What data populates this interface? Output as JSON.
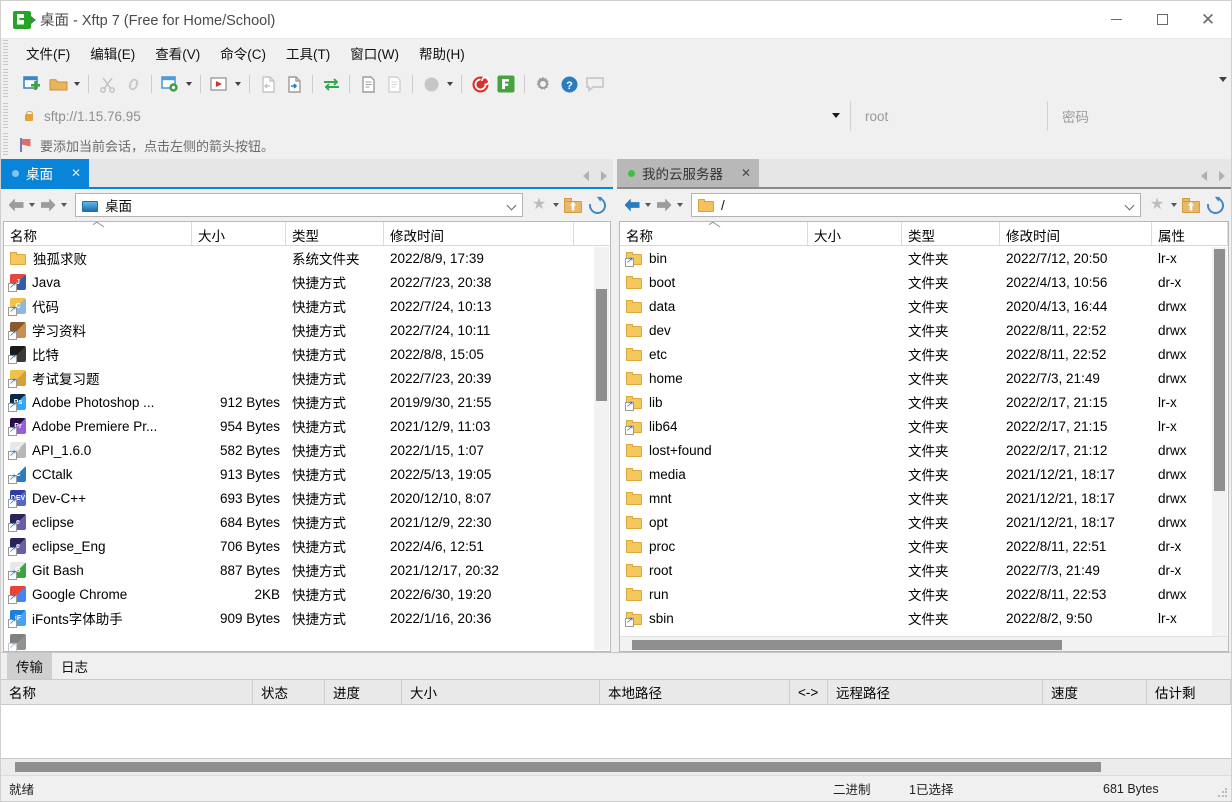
{
  "window": {
    "title": "桌面 - Xftp 7 (Free for Home/School)",
    "app_icon": "xftp-icon",
    "minimize_label": "",
    "maximize_label": "",
    "close_label": "✕"
  },
  "menubar": {
    "items": [
      {
        "label": "文件(F)"
      },
      {
        "label": "编辑(E)"
      },
      {
        "label": "查看(V)"
      },
      {
        "label": "命令(C)"
      },
      {
        "label": "工具(T)"
      },
      {
        "label": "窗口(W)"
      },
      {
        "label": "帮助(H)"
      }
    ]
  },
  "toolbar": {
    "buttons": [
      {
        "name": "new-session-icon",
        "color": "#3f87c8"
      },
      {
        "name": "open-folder-icon",
        "color": "#e0a33e"
      },
      {
        "name": "cut-icon",
        "color": "#c9c9c9"
      },
      {
        "name": "link-icon",
        "color": "#c9c9c9"
      },
      {
        "name": "session-settings-icon",
        "color": "#4c9ed9"
      },
      {
        "name": "run-icon",
        "color": "#cf4646"
      },
      {
        "name": "transfer-out-icon",
        "color": "#c9c9c9"
      },
      {
        "name": "transfer-in-icon",
        "color": "#2a7ec0"
      },
      {
        "name": "sync-transfer-icon",
        "color": "#2fa84f"
      },
      {
        "name": "copy-icon",
        "color": "#9c9c9c"
      },
      {
        "name": "paste-icon",
        "color": "#c9c9c9"
      },
      {
        "name": "mode-icon",
        "color": "#bdbdbd"
      },
      {
        "name": "xshell-icon",
        "color": "#d8322c"
      },
      {
        "name": "xftp-icon",
        "color": "#47a33c"
      },
      {
        "name": "options-icon",
        "color": "#9c9c9c"
      },
      {
        "name": "help-icon",
        "color": "#2a7ec0"
      },
      {
        "name": "feedback-icon",
        "color": "#bdbdbd"
      }
    ],
    "overflow_icon": "chevron-down-icon"
  },
  "sessionbar": {
    "lock_icon": "lock-icon",
    "url_value": "sftp://1.15.76.95",
    "url_dropdown_icon": "chevron-down-icon",
    "username_placeholder": "root",
    "password_placeholder": "密码"
  },
  "notice": {
    "icon": "flag-icon",
    "text": "要添加当前会话，点击左侧的箭头按钮。"
  },
  "left_pane": {
    "tab": {
      "label": "桌面",
      "dot": "blue",
      "close_icon": "✕",
      "active": true
    },
    "tab_nav": {
      "prev_icon": "chevron-left-icon",
      "next_icon": "chevron-right-icon"
    },
    "path": {
      "back_icon": "arrow-left-icon",
      "forward_icon": "arrow-right-icon",
      "folder_icon": "desktop-folder-icon",
      "value": "桌面",
      "dropdown_icon": "chevron-down-icon",
      "bookmark_icon": "star-icon",
      "bookmark_caret_icon": "chevron-down-icon",
      "up_icon": "up-folder-icon",
      "refresh_icon": "refresh-icon"
    },
    "columns": [
      "名称",
      "大小",
      "类型",
      "修改时间"
    ],
    "sort_column": "名称",
    "rows": [
      {
        "icon": "folder-icon",
        "name": "独孤求败",
        "size": "",
        "type": "系统文件夹",
        "time": "2022/8/9, 17:39"
      },
      {
        "icon": "java-icon",
        "name": "Java",
        "size": "",
        "type": "快捷方式",
        "time": "2022/7/23, 20:38"
      },
      {
        "icon": "code-icon",
        "name": "代码",
        "size": "",
        "type": "快捷方式",
        "time": "2022/7/24, 10:13"
      },
      {
        "icon": "study-icon",
        "name": "学习资料",
        "size": "",
        "type": "快捷方式",
        "time": "2022/7/24, 10:11"
      },
      {
        "icon": "bit-icon",
        "name": "比特",
        "size": "",
        "type": "快捷方式",
        "time": "2022/8/8, 15:05"
      },
      {
        "icon": "exam-icon",
        "name": "考试复习题",
        "size": "",
        "type": "快捷方式",
        "time": "2022/7/23, 20:39"
      },
      {
        "icon": "photoshop-icon",
        "name": "Adobe Photoshop ...",
        "size": "912 Bytes",
        "type": "快捷方式",
        "time": "2019/9/30, 21:55"
      },
      {
        "icon": "premiere-icon",
        "name": "Adobe Premiere Pr...",
        "size": "954 Bytes",
        "type": "快捷方式",
        "time": "2021/12/9, 11:03"
      },
      {
        "icon": "api-icon",
        "name": "API_1.6.0",
        "size": "582 Bytes",
        "type": "快捷方式",
        "time": "2022/1/15, 1:07"
      },
      {
        "icon": "cctalk-icon",
        "name": "CCtalk",
        "size": "913 Bytes",
        "type": "快捷方式",
        "time": "2022/5/13, 19:05"
      },
      {
        "icon": "devcpp-icon",
        "name": "Dev-C++",
        "size": "693 Bytes",
        "type": "快捷方式",
        "time": "2020/12/10, 8:07"
      },
      {
        "icon": "eclipse-icon",
        "name": "eclipse",
        "size": "684 Bytes",
        "type": "快捷方式",
        "time": "2021/12/9, 22:30"
      },
      {
        "icon": "eclipse-icon",
        "name": "eclipse_Eng",
        "size": "706 Bytes",
        "type": "快捷方式",
        "time": "2022/4/6, 12:51"
      },
      {
        "icon": "gitbash-icon",
        "name": "Git Bash",
        "size": "887 Bytes",
        "type": "快捷方式",
        "time": "2021/12/17, 20:32"
      },
      {
        "icon": "chrome-icon",
        "name": "Google Chrome",
        "size": "2KB",
        "type": "快捷方式",
        "time": "2022/6/30, 19:20"
      },
      {
        "icon": "ifonts-icon",
        "name": "iFonts字体助手",
        "size": "909 Bytes",
        "type": "快捷方式",
        "time": "2022/1/16, 20:36"
      },
      {
        "icon": "app-icon",
        "name": "",
        "size": "",
        "type": "",
        "time": ""
      }
    ]
  },
  "right_pane": {
    "tab": {
      "label": "我的云服务器",
      "dot": "green",
      "close_icon": "✕",
      "active": false
    },
    "tab_nav": {
      "prev_icon": "chevron-left-icon",
      "next_icon": "chevron-right-icon"
    },
    "path": {
      "back_icon": "arrow-left-icon",
      "forward_icon": "arrow-right-icon",
      "folder_icon": "folder-icon",
      "value": "/",
      "dropdown_icon": "chevron-down-icon",
      "bookmark_icon": "star-icon",
      "bookmark_caret_icon": "chevron-down-icon",
      "up_icon": "up-folder-icon",
      "refresh_icon": "refresh-icon"
    },
    "columns": [
      "名称",
      "大小",
      "类型",
      "修改时间",
      "属性"
    ],
    "sort_column": "名称",
    "rows": [
      {
        "icon": "link-folder-icon",
        "name": "bin",
        "size": "",
        "type": "文件夹",
        "time": "2022/7/12, 20:50",
        "attr": "lr-x"
      },
      {
        "icon": "folder-icon",
        "name": "boot",
        "size": "",
        "type": "文件夹",
        "time": "2022/4/13, 10:56",
        "attr": "dr-x"
      },
      {
        "icon": "folder-icon",
        "name": "data",
        "size": "",
        "type": "文件夹",
        "time": "2020/4/13, 16:44",
        "attr": "drwx"
      },
      {
        "icon": "folder-icon",
        "name": "dev",
        "size": "",
        "type": "文件夹",
        "time": "2022/8/11, 22:52",
        "attr": "drwx"
      },
      {
        "icon": "folder-icon",
        "name": "etc",
        "size": "",
        "type": "文件夹",
        "time": "2022/8/11, 22:52",
        "attr": "drwx"
      },
      {
        "icon": "folder-icon",
        "name": "home",
        "size": "",
        "type": "文件夹",
        "time": "2022/7/3, 21:49",
        "attr": "drwx"
      },
      {
        "icon": "link-folder-icon",
        "name": "lib",
        "size": "",
        "type": "文件夹",
        "time": "2022/2/17, 21:15",
        "attr": "lr-x"
      },
      {
        "icon": "link-folder-icon",
        "name": "lib64",
        "size": "",
        "type": "文件夹",
        "time": "2022/2/17, 21:15",
        "attr": "lr-x"
      },
      {
        "icon": "folder-icon",
        "name": "lost+found",
        "size": "",
        "type": "文件夹",
        "time": "2022/2/17, 21:12",
        "attr": "drwx"
      },
      {
        "icon": "folder-icon",
        "name": "media",
        "size": "",
        "type": "文件夹",
        "time": "2021/12/21, 18:17",
        "attr": "drwx"
      },
      {
        "icon": "folder-icon",
        "name": "mnt",
        "size": "",
        "type": "文件夹",
        "time": "2021/12/21, 18:17",
        "attr": "drwx"
      },
      {
        "icon": "folder-icon",
        "name": "opt",
        "size": "",
        "type": "文件夹",
        "time": "2021/12/21, 18:17",
        "attr": "drwx"
      },
      {
        "icon": "folder-icon",
        "name": "proc",
        "size": "",
        "type": "文件夹",
        "time": "2022/8/11, 22:51",
        "attr": "dr-x"
      },
      {
        "icon": "folder-icon",
        "name": "root",
        "size": "",
        "type": "文件夹",
        "time": "2022/7/3, 21:49",
        "attr": "dr-x"
      },
      {
        "icon": "folder-icon",
        "name": "run",
        "size": "",
        "type": "文件夹",
        "time": "2022/8/11, 22:53",
        "attr": "drwx"
      },
      {
        "icon": "link-folder-icon",
        "name": "sbin",
        "size": "",
        "type": "文件夹",
        "time": "2022/8/2, 9:50",
        "attr": "lr-x"
      }
    ]
  },
  "transfer_panel": {
    "tabs": [
      {
        "label": "传输",
        "selected": true
      },
      {
        "label": "日志",
        "selected": false
      }
    ],
    "columns": [
      "名称",
      "状态",
      "进度",
      "大小",
      "本地路径",
      "<->",
      "远程路径",
      "速度",
      "估计剩"
    ],
    "rows": []
  },
  "statusbar": {
    "ready": "就绪",
    "mode": "二进制",
    "selection": "1已选择",
    "size": "681 Bytes"
  }
}
